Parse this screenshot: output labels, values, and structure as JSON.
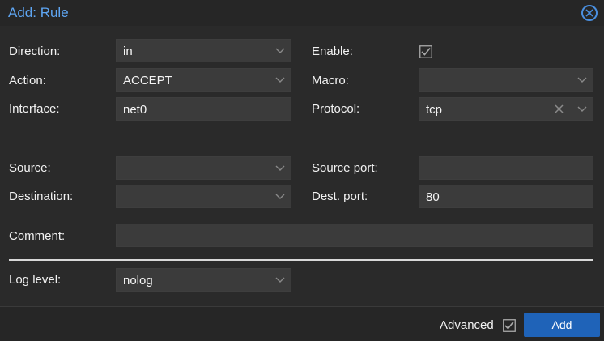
{
  "dialog": {
    "title": "Add: Rule"
  },
  "fields": {
    "direction": {
      "label": "Direction:",
      "value": "in"
    },
    "action": {
      "label": "Action:",
      "value": "ACCEPT"
    },
    "interface": {
      "label": "Interface:",
      "value": "net0"
    },
    "source": {
      "label": "Source:",
      "value": ""
    },
    "destination": {
      "label": "Destination:",
      "value": ""
    },
    "comment": {
      "label": "Comment:",
      "value": ""
    },
    "log_level": {
      "label": "Log level:",
      "value": "nolog"
    },
    "enable": {
      "label": "Enable:",
      "checked": true
    },
    "macro": {
      "label": "Macro:",
      "value": ""
    },
    "protocol": {
      "label": "Protocol:",
      "value": "tcp"
    },
    "source_port": {
      "label": "Source port:",
      "value": ""
    },
    "dest_port": {
      "label": "Dest. port:",
      "value": "80"
    }
  },
  "footer": {
    "advanced_label": "Advanced",
    "advanced_checked": false,
    "add_label": "Add"
  },
  "icons": {
    "close": "close-circle-icon",
    "dropdown": "chevron-down-icon",
    "clear": "x-clear-icon",
    "check": "checkbox-checked-icon"
  },
  "colors": {
    "accent": "#5ea5f2",
    "primary_button": "#1f63b8",
    "background": "#2a2a2a",
    "field": "#3b3b3b"
  }
}
